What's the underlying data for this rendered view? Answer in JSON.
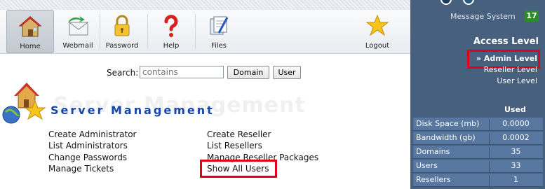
{
  "toolbar": {
    "items": [
      {
        "label": "Home",
        "icon": "home-icon"
      },
      {
        "label": "Webmail",
        "icon": "webmail-icon"
      },
      {
        "label": "Password",
        "icon": "lock-icon"
      },
      {
        "label": "Help",
        "icon": "question-icon"
      },
      {
        "label": "Files",
        "icon": "files-icon"
      },
      {
        "label": "Logout",
        "icon": "star-icon"
      }
    ]
  },
  "search": {
    "label": "Search:",
    "placeholder": "contains",
    "domain_button": "Domain",
    "user_button": "User"
  },
  "server_management": {
    "title": "Server Management",
    "left_links": [
      "Create Administrator",
      "List Administrators",
      "Change Passwords",
      "Manage Tickets"
    ],
    "right_links": [
      "Create Reseller",
      "List Resellers",
      "Manage Reseller Packages",
      "Show All Users"
    ]
  },
  "sidebar": {
    "message_system_label": "Message System",
    "message_count": "17",
    "access_level_title": "Access Level",
    "levels": [
      {
        "label": "» Admin Level",
        "active": true
      },
      {
        "label": "Reseller Level",
        "active": false
      },
      {
        "label": "User Level",
        "active": false
      }
    ],
    "stats_header": "Used",
    "stats": [
      {
        "name": "Disk Space (mb)",
        "value": "0.0000"
      },
      {
        "name": "Bandwidth (gb)",
        "value": "0.0002"
      },
      {
        "name": "Domains",
        "value": "35"
      },
      {
        "name": "Users",
        "value": "33"
      },
      {
        "name": "Resellers",
        "value": "1"
      }
    ]
  },
  "colors": {
    "sidebar_bg": "#46607d",
    "stat_row_bg": "#5776a0",
    "highlight": "#e0001b",
    "title_blue": "#1746a8",
    "badge_green": "#2f8a2a"
  }
}
